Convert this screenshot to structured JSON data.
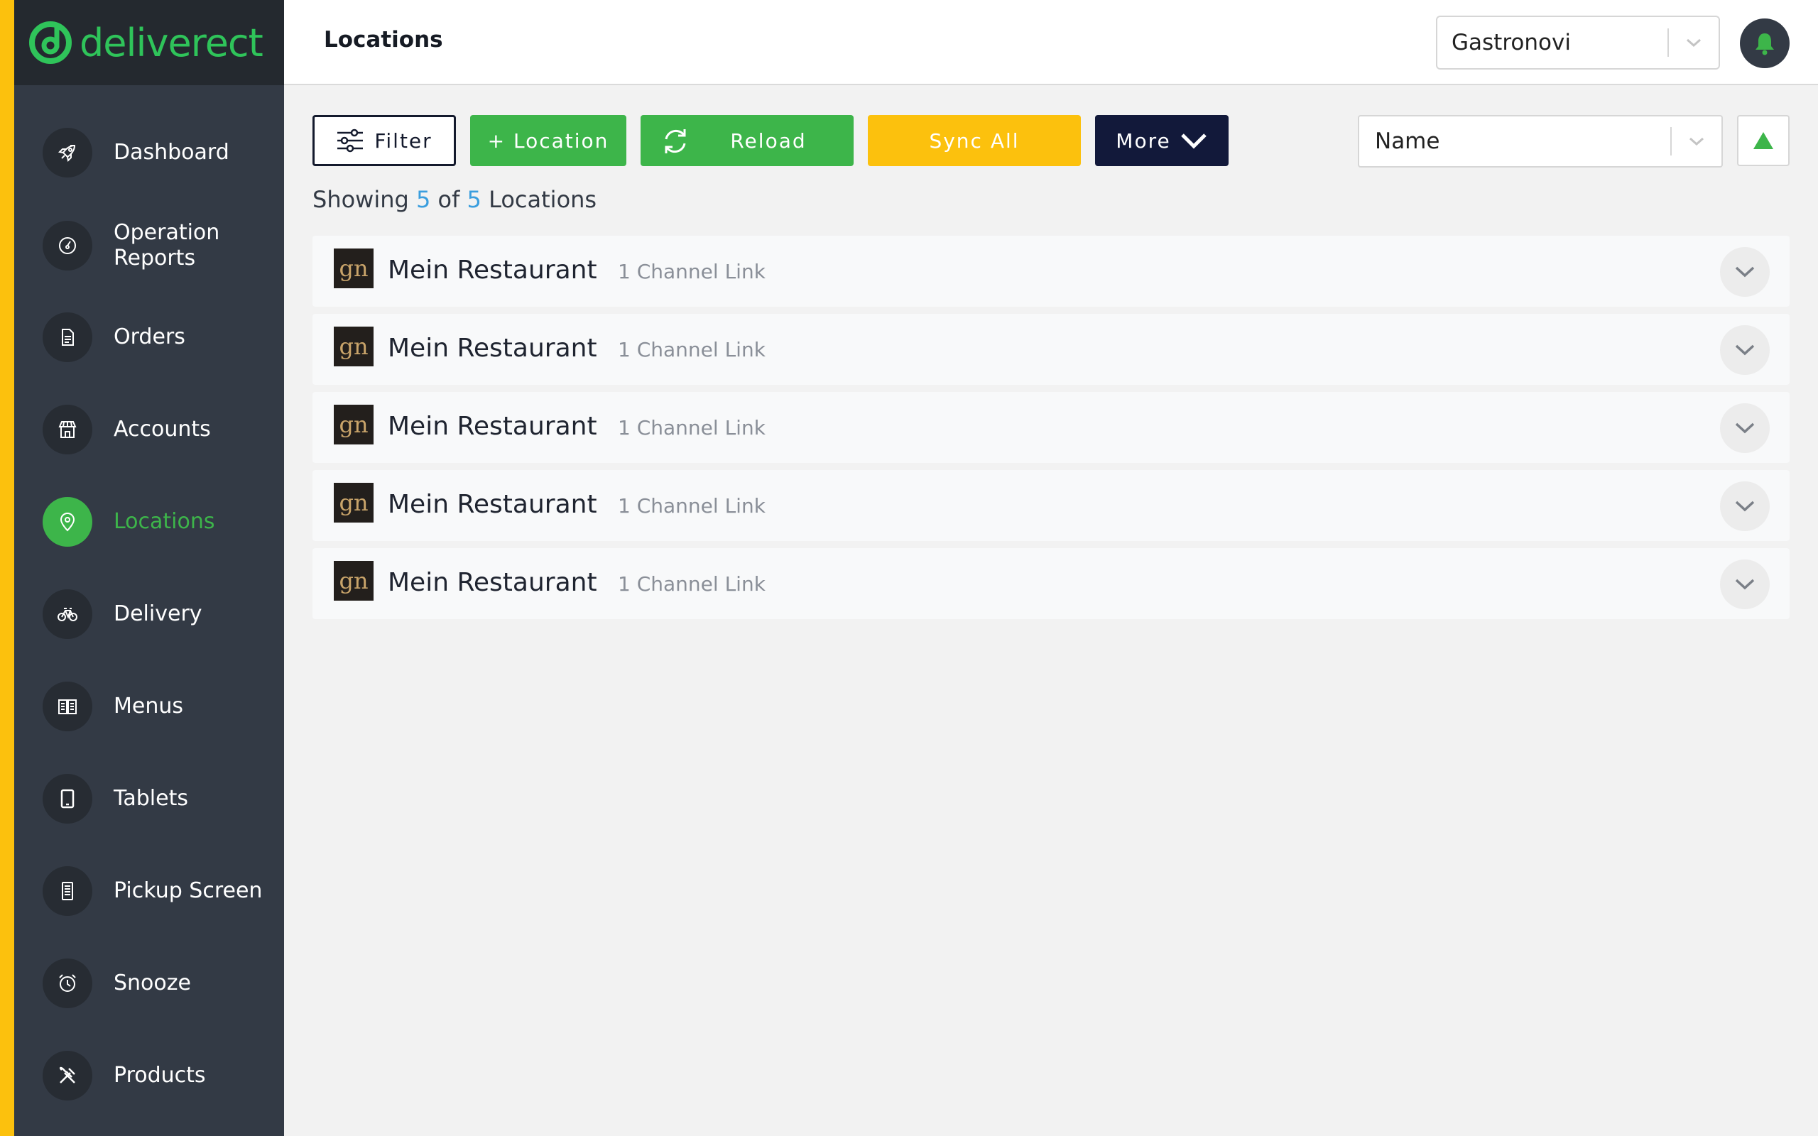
{
  "brand": {
    "logo_text": "deliverect",
    "accent": "#3db54a",
    "strip_color": "#fcc10d"
  },
  "header": {
    "title": "Locations",
    "account_select": "Gastronovi",
    "notification_icon": "bell-icon"
  },
  "sidebar": {
    "items": [
      {
        "label": "Dashboard",
        "icon": "rocket-icon",
        "active": false
      },
      {
        "label": "Operation\nReports",
        "icon": "gauge-icon",
        "active": false
      },
      {
        "label": "Orders",
        "icon": "document-icon",
        "active": false
      },
      {
        "label": "Accounts",
        "icon": "store-icon",
        "active": false
      },
      {
        "label": "Locations",
        "icon": "location-pin-icon",
        "active": true
      },
      {
        "label": "Delivery",
        "icon": "bicycle-icon",
        "active": false
      },
      {
        "label": "Menus",
        "icon": "book-icon",
        "active": false
      },
      {
        "label": "Tablets",
        "icon": "tablet-icon",
        "active": false
      },
      {
        "label": "Pickup Screen",
        "icon": "receipt-icon",
        "active": false
      },
      {
        "label": "Snooze",
        "icon": "alarm-clock-icon",
        "active": false
      },
      {
        "label": "Products",
        "icon": "utensils-icon",
        "active": false
      }
    ]
  },
  "toolbar": {
    "filter_label": "Filter",
    "add_location_label": "+ Location",
    "reload_label": "Reload",
    "sync_all_label": "Sync All",
    "more_label": "More",
    "sort_select": "Name",
    "sort_direction": "ascending"
  },
  "summary": {
    "prefix": "Showing",
    "shown": "5",
    "of": "of",
    "total": "5",
    "suffix": "Locations"
  },
  "locations": [
    {
      "logo_text": "gn",
      "name": "Mein Restaurant",
      "channel_links": "1 Channel Link"
    },
    {
      "logo_text": "gn",
      "name": "Mein Restaurant",
      "channel_links": "1 Channel Link"
    },
    {
      "logo_text": "gn",
      "name": "Mein Restaurant",
      "channel_links": "1 Channel Link"
    },
    {
      "logo_text": "gn",
      "name": "Mein Restaurant",
      "channel_links": "1 Channel Link"
    },
    {
      "logo_text": "gn",
      "name": "Mein Restaurant",
      "channel_links": "1 Channel Link"
    }
  ]
}
